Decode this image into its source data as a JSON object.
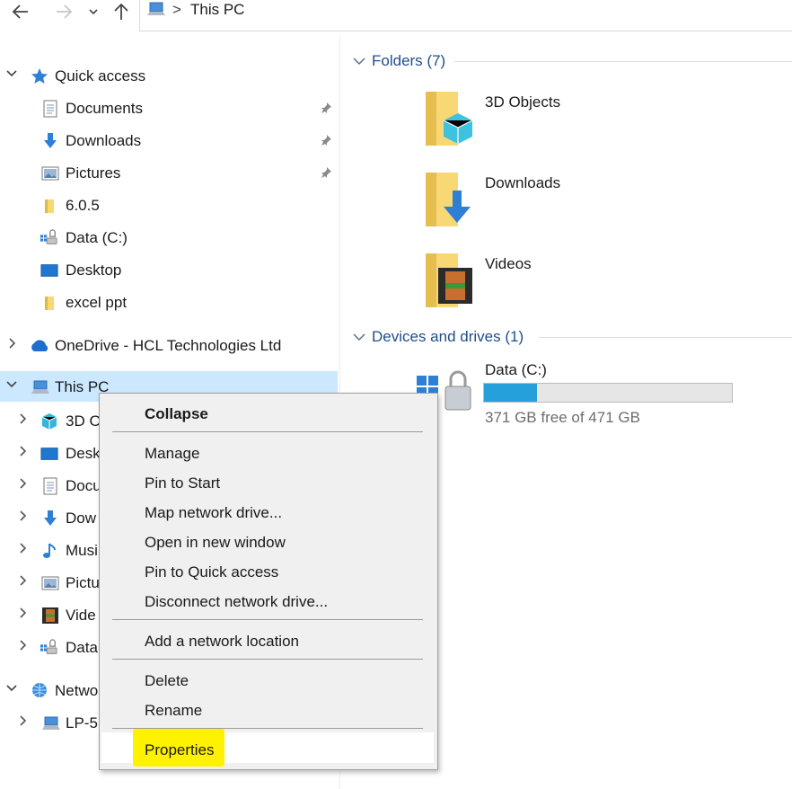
{
  "address": {
    "location": "This PC"
  },
  "sidebar": {
    "quick_access": {
      "label": "Quick access",
      "items": [
        {
          "label": "Documents",
          "icon": "documents-icon",
          "pinned": true
        },
        {
          "label": "Downloads",
          "icon": "downloads-icon",
          "pinned": true
        },
        {
          "label": "Pictures",
          "icon": "pictures-icon",
          "pinned": true
        },
        {
          "label": "6.0.5",
          "icon": "folder-icon"
        },
        {
          "label": "Data (C:)",
          "icon": "drive-icon"
        },
        {
          "label": "Desktop",
          "icon": "desktop-icon"
        },
        {
          "label": "excel ppt",
          "icon": "folder-icon"
        }
      ]
    },
    "onedrive": {
      "label": "OneDrive - HCL Technologies Ltd"
    },
    "this_pc": {
      "label": "This PC",
      "children": [
        "3D O",
        "Desk",
        "Docu",
        "Dow",
        "Musi",
        "Pictu",
        "Vide",
        "Data"
      ]
    },
    "network": {
      "label": "Netwo",
      "children": [
        "LP-5"
      ]
    }
  },
  "content": {
    "folders_header": "Folders (7)",
    "folders": [
      "3D Objects",
      "Downloads",
      "Videos"
    ],
    "drives_header": "Devices and drives (1)",
    "drive": {
      "name": "Data (C:)",
      "free_text": "371 GB free of 471 GB",
      "used_fraction": 0.212
    }
  },
  "context_menu": {
    "collapse": "Collapse",
    "manage": "Manage",
    "pin_start": "Pin to Start",
    "map_drive": "Map network drive...",
    "open_new": "Open in new window",
    "pin_quick": "Pin to Quick access",
    "disconnect": "Disconnect network drive...",
    "add_location": "Add a network location",
    "delete": "Delete",
    "rename": "Rename",
    "properties": "Properties",
    "highlight_color": "#fff200"
  },
  "colors": {
    "selection": "#cce8ff",
    "accent": "#26a0da",
    "header_text": "#1f4e8c"
  }
}
